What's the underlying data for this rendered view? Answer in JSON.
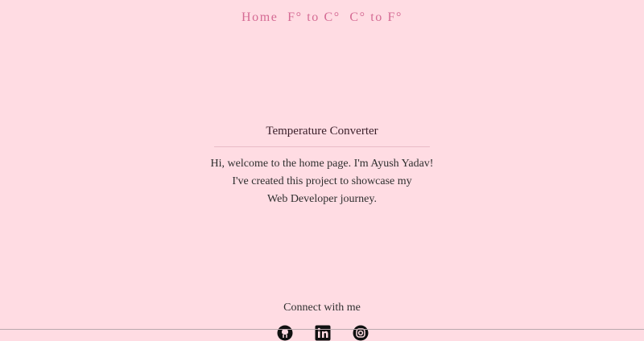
{
  "nav": {
    "home": "Home",
    "f_to_c": "F° to C°",
    "c_to_f": "C° to F°"
  },
  "main": {
    "title": "Temperature Converter",
    "intro_line1": "Hi, welcome to the home page. I'm Ayush Yadav!",
    "intro_line2": "I've created this project to showcase my",
    "intro_line3": "Web Developer journey."
  },
  "footer": {
    "connect_label": "Connect with me",
    "icons": [
      "github-icon",
      "linkedin-icon",
      "instagram-icon"
    ]
  },
  "colors": {
    "background": "#ffdce3",
    "nav_link": "#d56b94",
    "text": "#2f2f2f"
  }
}
